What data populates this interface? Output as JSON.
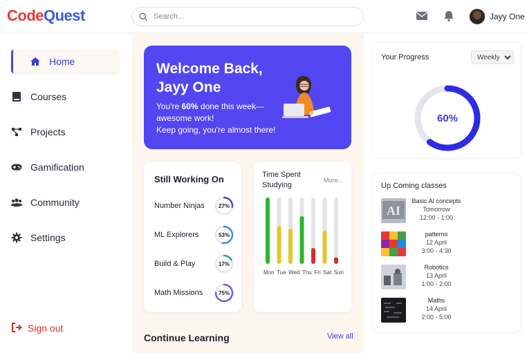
{
  "brand": {
    "part1": "Code",
    "part2": "Quest"
  },
  "search": {
    "placeholder": "Search..."
  },
  "user": {
    "name": "Jayy One"
  },
  "sidebar": {
    "items": [
      {
        "label": "Home",
        "icon": "home-icon"
      },
      {
        "label": "Courses",
        "icon": "book-icon"
      },
      {
        "label": "Projects",
        "icon": "project-diagram-icon"
      },
      {
        "label": "Gamification",
        "icon": "gamepad-icon"
      },
      {
        "label": "Community",
        "icon": "users-icon"
      },
      {
        "label": "Settings",
        "icon": "gear-icon"
      }
    ],
    "signout": "Sign out"
  },
  "welcome": {
    "title": "Welcome Back, Jayy One",
    "line1_pre": "You're ",
    "line1_bold": "60%",
    "line1_post": " done this week—awesome work!",
    "line2": "Keep going, you're almost there!"
  },
  "working": {
    "title": "Still Working On",
    "items": [
      {
        "name": "Number Ninjas",
        "pct": "27%",
        "value": 0.27,
        "color": "#4b45d6"
      },
      {
        "name": "ML Explorers",
        "pct": "53%",
        "value": 0.53,
        "color": "#3a8ee6"
      },
      {
        "name": "Build & Play",
        "pct": "17%",
        "value": 0.17,
        "color": "#2aa876"
      },
      {
        "name": "Math Missions",
        "pct": "75%",
        "value": 0.75,
        "color": "#6a5af9"
      }
    ]
  },
  "time_spent": {
    "title": "Time Spent Studying",
    "more": "More...",
    "days": [
      "Mon",
      "Tue",
      "Wed",
      "Thu",
      "Fri",
      "Sat",
      "Sun"
    ],
    "levels": [
      1.0,
      0.57,
      0.53,
      0.72,
      0.24,
      0.5,
      0.1
    ],
    "colors": [
      "#2db52d",
      "#e3c62b",
      "#e3c62b",
      "#2db52d",
      "#d32f2f",
      "#e3c62b",
      "#d32f2f"
    ]
  },
  "continue": {
    "title": "Continue Learning",
    "view_all": "View all"
  },
  "progress": {
    "title": "Your Progress",
    "period": "Weekly",
    "period_options": [
      "Weekly"
    ],
    "percent_label": "60%",
    "value": 0.6,
    "accent": "#2e2be6"
  },
  "classes": {
    "title": "Up Coming classes",
    "items": [
      {
        "name": "Basic AI concepts",
        "date": "Tomorrow",
        "time": "12:00 - 1:00",
        "thumb": "ai-thumbnail"
      },
      {
        "name": "patterns",
        "date": "12 April",
        "time": "3:00 - 4:30",
        "thumb": "patterns-thumbnail"
      },
      {
        "name": "Robotics",
        "date": "13 April",
        "time": "1:00 - 2:00",
        "thumb": "robotics-thumbnail"
      },
      {
        "name": "Maths",
        "date": "14 April",
        "time": "2:00 - 5:00",
        "thumb": "maths-thumbnail"
      }
    ]
  }
}
